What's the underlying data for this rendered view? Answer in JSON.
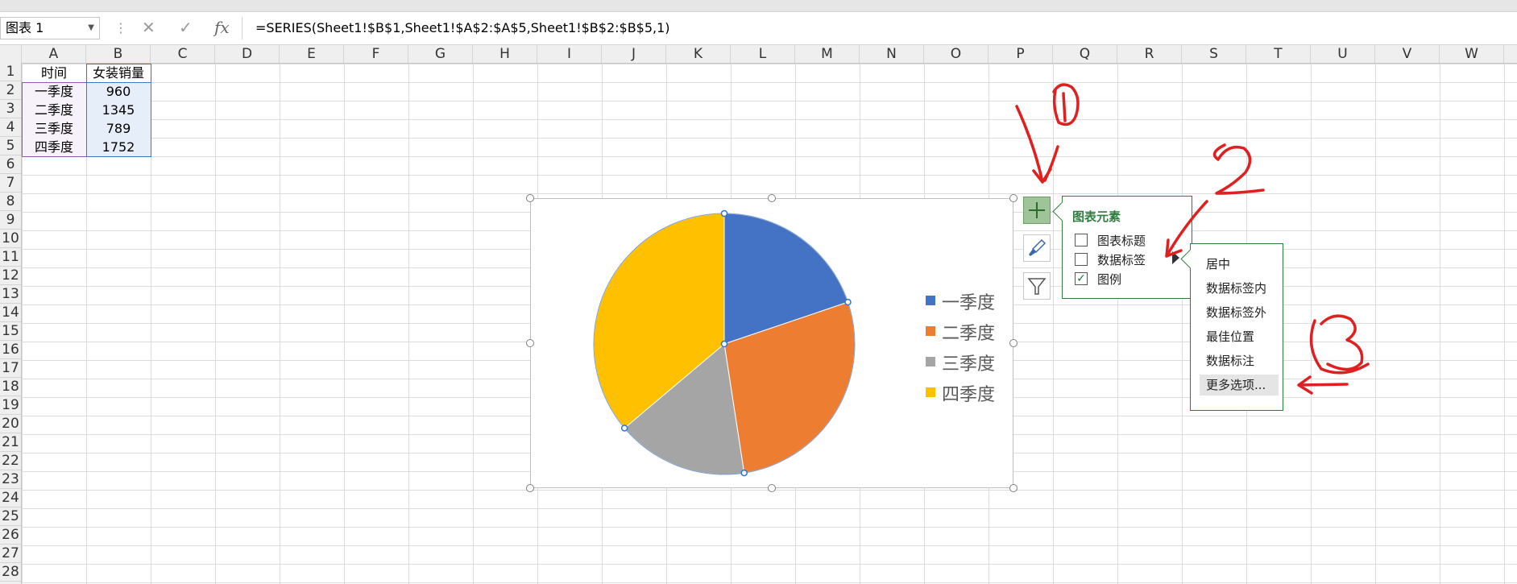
{
  "formula_bar": {
    "name_box": "图表 1",
    "cancel_icon": "✕",
    "enter_icon": "✓",
    "fx_label": "fx",
    "formula": "=SERIES(Sheet1!$B$1,Sheet1!$A$2:$A$5,Sheet1!$B$2:$B$5,1)"
  },
  "columns": [
    "A",
    "B",
    "C",
    "D",
    "E",
    "F",
    "G",
    "H",
    "I",
    "J",
    "K",
    "L",
    "M",
    "N",
    "O",
    "P",
    "Q",
    "R",
    "S",
    "T",
    "U",
    "V",
    "W"
  ],
  "rows": [
    "1",
    "2",
    "3",
    "4",
    "5",
    "6",
    "7",
    "8",
    "9",
    "10",
    "11",
    "12",
    "13",
    "14",
    "15",
    "16",
    "17",
    "18",
    "19",
    "20",
    "21",
    "22",
    "23",
    "24",
    "25",
    "26",
    "27",
    "28"
  ],
  "table": {
    "header": [
      "时间",
      "女装销量"
    ],
    "rows": [
      [
        "一季度",
        "960"
      ],
      [
        "二季度",
        "1345"
      ],
      [
        "三季度",
        "789"
      ],
      [
        "四季度",
        "1752"
      ]
    ]
  },
  "chart_data": {
    "type": "pie",
    "categories": [
      "一季度",
      "二季度",
      "三季度",
      "四季度"
    ],
    "values": [
      960,
      1345,
      789,
      1752
    ],
    "colors": [
      "#4472C4",
      "#ED7D31",
      "#A5A5A5",
      "#FFC000"
    ],
    "legend_position": "right",
    "title": ""
  },
  "chart_elements_panel": {
    "title": "图表元素",
    "items": [
      {
        "label": "图表标题",
        "checked": false
      },
      {
        "label": "数据标签",
        "checked": false
      },
      {
        "label": "图例",
        "checked": true
      }
    ]
  },
  "data_label_options": [
    "居中",
    "数据标签内",
    "数据标签外",
    "最佳位置",
    "数据标注",
    "更多选项..."
  ],
  "side_buttons": [
    "plus-icon",
    "brush-icon",
    "filter-icon"
  ],
  "annotation_color": "#e02020"
}
